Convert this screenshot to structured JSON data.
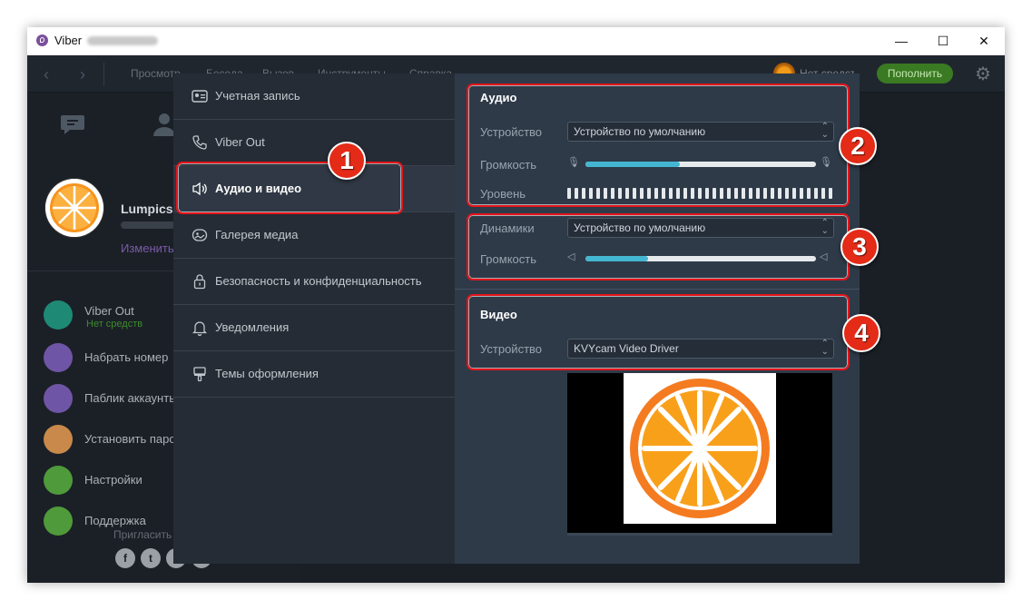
{
  "window": {
    "title": "Viber",
    "controls": {
      "minimize": "—",
      "maximize": "☐",
      "close": "✕"
    }
  },
  "menubar": {
    "back": "‹",
    "forward": "›",
    "items": [
      "Просмотр",
      "Беседа",
      "Вызов",
      "Инструменты",
      "Справка"
    ],
    "account_text": "Нет средств",
    "topup_label": "Пополнить"
  },
  "left_panel": {
    "profile_name": "Lumpics",
    "profile_edit": "Изменить",
    "items": [
      {
        "label": "Viber Out",
        "sublabel": "Нет средств",
        "color": "#1e8a76"
      },
      {
        "label": "Набрать номер",
        "color": "#6f55a6"
      },
      {
        "label": "Паблик аккаунты",
        "color": "#6f55a6"
      },
      {
        "label": "Установить пароль",
        "color": "#c8894a"
      },
      {
        "label": "Настройки",
        "color": "#4f9a3a"
      },
      {
        "label": "Поддержка",
        "color": "#4f9a3a"
      }
    ],
    "invite": "Пригласить",
    "social": [
      "f",
      "t",
      "",
      ""
    ]
  },
  "settings_menu": {
    "items": [
      {
        "label": "Учетная запись",
        "icon": "id-card-icon"
      },
      {
        "label": "Viber Out",
        "icon": "phone-icon"
      },
      {
        "label": "Аудио и видео",
        "icon": "speaker-icon",
        "active": true
      },
      {
        "label": "Галерея медиа",
        "icon": "image-icon"
      },
      {
        "label": "Безопасность и конфиденциальность",
        "icon": "lock-icon"
      },
      {
        "label": "Уведомления",
        "icon": "bell-icon"
      },
      {
        "label": "Темы оформления",
        "icon": "brush-icon"
      }
    ]
  },
  "audio": {
    "heading": "Аудио",
    "device_label": "Устройство",
    "device_value": "Устройство по умолчанию",
    "volume_label": "Громкость",
    "volume_fraction": 0.41,
    "level_label": "Уровень"
  },
  "speakers": {
    "device_label": "Динамики",
    "device_value": "Устройство по умолчанию",
    "volume_label": "Громкость",
    "volume_fraction": 0.27
  },
  "video": {
    "heading": "Видео",
    "device_label": "Устройство",
    "device_value": "KVYcam Video Driver"
  },
  "callouts": [
    "1",
    "2",
    "3",
    "4"
  ],
  "colors": {
    "accent": "#44b6d1",
    "callout_red": "#e4141a",
    "orange": "#f7941d"
  }
}
